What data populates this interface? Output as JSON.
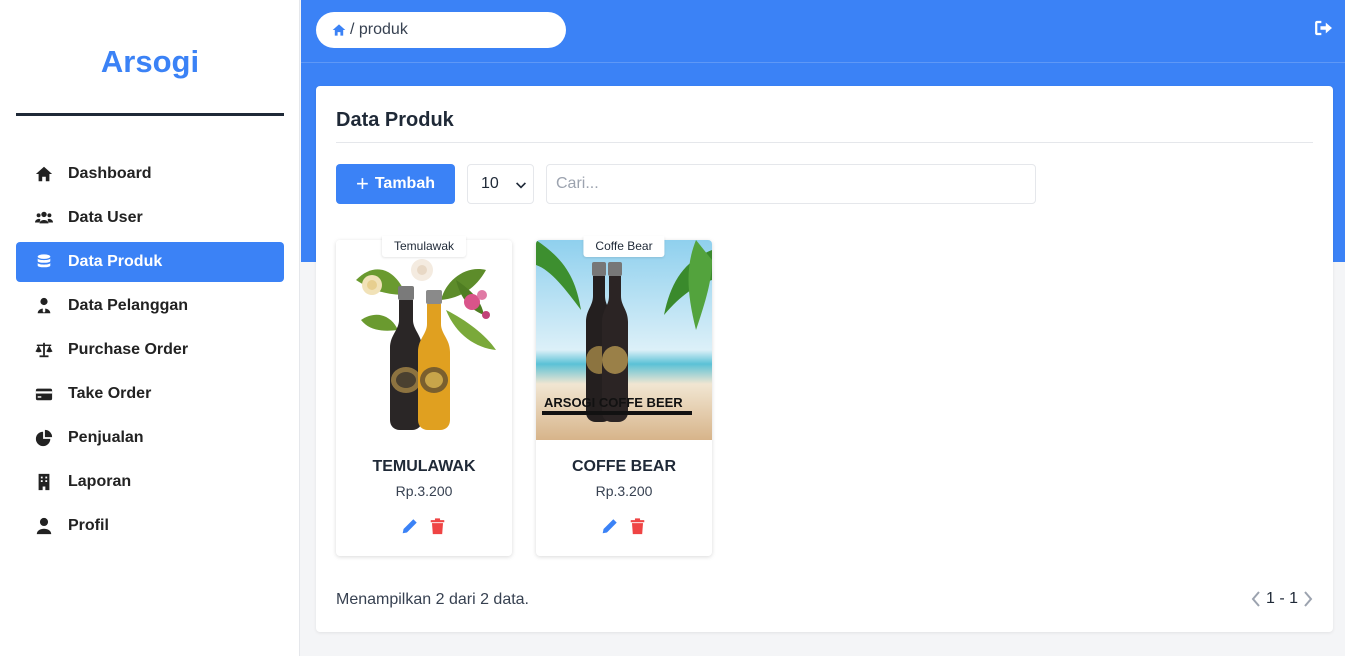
{
  "brand": "Arsogi",
  "sidebar": {
    "items": [
      {
        "label": "Dashboard",
        "icon": "home-icon",
        "active": false
      },
      {
        "label": "Data User",
        "icon": "users-icon",
        "active": false
      },
      {
        "label": "Data Produk",
        "icon": "database-icon",
        "active": true
      },
      {
        "label": "Data Pelanggan",
        "icon": "user-tie-icon",
        "active": false
      },
      {
        "label": "Purchase Order",
        "icon": "scale-icon",
        "active": false
      },
      {
        "label": "Take Order",
        "icon": "credit-card-icon",
        "active": false
      },
      {
        "label": "Penjualan",
        "icon": "pie-chart-icon",
        "active": false
      },
      {
        "label": "Laporan",
        "icon": "building-icon",
        "active": false
      },
      {
        "label": "Profil",
        "icon": "user-icon",
        "active": false
      }
    ]
  },
  "header": {
    "breadcrumb": "/ produk",
    "breadcrumb_icon": "home-icon",
    "logout_icon": "sign-out-icon"
  },
  "main": {
    "title": "Data Produk",
    "add_label": "Tambah",
    "page_size": "10",
    "search_placeholder": "Cari...",
    "products": [
      {
        "tag": "Temulawak",
        "name": "TEMULAWAK",
        "price": "Rp.3.200"
      },
      {
        "tag": "Coffe Bear",
        "name": "COFFE BEAR",
        "price": "Rp.3.200",
        "image_text": "ARSOGI COFFE BEER"
      }
    ],
    "summary": "Menampilkan 2 dari 2 data.",
    "pagination": "1 - 1"
  },
  "colors": {
    "accent": "#3b82f6",
    "delete": "#ef4444",
    "edit": "#3b82f6"
  }
}
